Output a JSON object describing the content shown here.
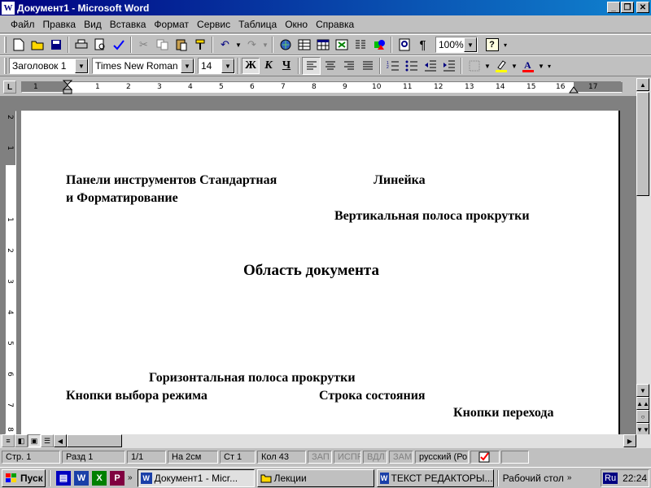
{
  "window": {
    "title": "Документ1 - Microsoft Word",
    "icon": "W",
    "minimize": "_",
    "maximize": "❐",
    "close": "✕"
  },
  "menu": {
    "items": [
      {
        "label": "Файл"
      },
      {
        "label": "Правка"
      },
      {
        "label": "Вид"
      },
      {
        "label": "Вставка"
      },
      {
        "label": "Формат"
      },
      {
        "label": "Сервис"
      },
      {
        "label": "Таблица"
      },
      {
        "label": "Окно"
      },
      {
        "label": "Справка"
      }
    ]
  },
  "standard_toolbar": {
    "zoom": "100%",
    "help": "?"
  },
  "formatting_toolbar": {
    "style": "Заголовок 1",
    "font": "Times New Roman",
    "size": "14",
    "bold": "Ж",
    "italic": "К",
    "underline": "Ч",
    "highlight_color": "#ffff00",
    "font_color": "#ff0000"
  },
  "ruler": {
    "corner": "L",
    "ticks": [
      "1",
      "2",
      "1",
      "2",
      "3",
      "4",
      "5",
      "6",
      "7",
      "8",
      "9",
      "10",
      "11",
      "12",
      "13",
      "14",
      "15",
      "16",
      "17"
    ],
    "vticks": [
      "2",
      "1",
      "1",
      "2",
      "3",
      "4",
      "5",
      "6",
      "7",
      "8"
    ]
  },
  "document": {
    "labels": {
      "toolbars_line1": "Панели инструментов Стандартная",
      "toolbars_line2": "и Форматирование",
      "ruler": "Линейка",
      "vscroll": "Вертикальная полоса прокрутки",
      "doc_area": "Область документа",
      "hscroll": "Горизонтальная полоса прокрутки",
      "view_buttons": "Кнопки выбора режима",
      "status_bar": "Строка состояния",
      "nav_buttons": "Кнопки перехода"
    }
  },
  "statusbar": {
    "page": "Стр.  1",
    "section": "Разд  1",
    "pages": "1/1",
    "at": "На  2см",
    "line": "Ст  1",
    "col": "Кол  43",
    "rec": "ЗАП",
    "trk": "ИСПР",
    "ext": "ВДЛ",
    "ovr": "ЗАМ",
    "lang": "русский (Ро"
  },
  "taskbar": {
    "start": "Пуск",
    "tasks": [
      {
        "label": "Документ1 - Micr..."
      },
      {
        "label": "Лекции"
      },
      {
        "label": "ТЕКСТ РЕДАКТОРЫ..."
      },
      {
        "label": "Рабочий стол"
      }
    ],
    "lang": "Ru",
    "time": "22:24"
  }
}
